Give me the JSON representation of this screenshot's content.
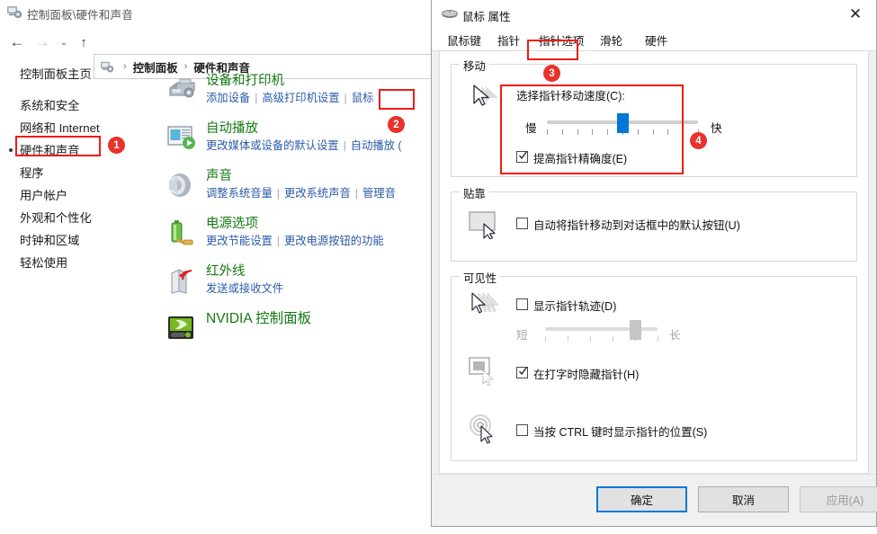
{
  "explorer": {
    "title": "控制面板\\硬件和声音",
    "title_icon": "control-panel-icon",
    "close_label": "✕",
    "nav": {
      "back": "←",
      "forward": "→",
      "recent": "⌄",
      "up": "↑"
    },
    "breadcrumb": {
      "items": [
        "控制面板",
        "硬件和声音"
      ],
      "separator": "›"
    },
    "search_icon": "search-icon",
    "left_nav": {
      "home": "控制面板主页",
      "items": [
        "系统和安全",
        "网络和 Internet",
        "硬件和声音",
        "程序",
        "用户帐户",
        "外观和个性化",
        "时钟和区域",
        "轻松使用"
      ],
      "selected": "硬件和声音"
    },
    "categories": [
      {
        "icon": "printer-icon",
        "title": "设备和打印机",
        "links": [
          "添加设备",
          "高级打印机设置",
          "鼠标"
        ]
      },
      {
        "icon": "autoplay-icon",
        "title": "自动播放",
        "links": [
          "更改媒体或设备的默认设置",
          "自动播放 ("
        ]
      },
      {
        "icon": "speaker-icon",
        "title": "声音",
        "links": [
          "调整系统音量",
          "更改系统声音",
          "管理音"
        ]
      },
      {
        "icon": "battery-icon",
        "title": "电源选项",
        "links": [
          "更改节能设置",
          "更改电源按钮的功能"
        ]
      },
      {
        "icon": "infrared-icon",
        "title": "红外线",
        "links": [
          "发送或接收文件"
        ]
      },
      {
        "icon": "nvidia-icon",
        "title": "NVIDIA 控制面板",
        "links": []
      }
    ]
  },
  "annotations": {
    "accent_color": "#e8322b",
    "markers": [
      "1",
      "2",
      "3",
      "4"
    ]
  },
  "dialog": {
    "title": "鼠标 属性",
    "title_icon": "mouse-icon",
    "close_label": "✕",
    "tabs": [
      {
        "label": "鼠标键",
        "active": false
      },
      {
        "label": "指针",
        "active": false
      },
      {
        "label": "指针选项",
        "active": true
      },
      {
        "label": "滑轮",
        "active": false
      },
      {
        "label": "硬件",
        "active": false
      }
    ],
    "groups": {
      "motion": {
        "label": "移动",
        "icon": "pointer-speed-icon",
        "speed_label": "选择指针移动速度(C):",
        "slider": {
          "min_label": "慢",
          "max_label": "快",
          "ticks": 11,
          "value": 5,
          "enabled": true
        },
        "enhance_precision": {
          "label": "提高指针精确度(E)",
          "checked": true,
          "enabled": true
        }
      },
      "snap": {
        "label": "贴靠",
        "icon": "snap-to-button-icon",
        "snap_default": {
          "label": "自动将指针移动到对话框中的默认按钮(U)",
          "checked": false,
          "enabled": true
        }
      },
      "visibility": {
        "label": "可见性",
        "trails": {
          "icon": "pointer-trails-icon",
          "label": "显示指针轨迹(D)",
          "checked": false,
          "enabled": true,
          "slider": {
            "min_label": "短",
            "max_label": "长",
            "ticks": 6,
            "value": 5,
            "enabled": false
          }
        },
        "hide_typing": {
          "icon": "hide-while-typing-icon",
          "label": "在打字时隐藏指针(H)",
          "checked": true,
          "enabled": true
        },
        "show_location": {
          "icon": "ctrl-locate-icon",
          "label": "当按 CTRL 键时显示指针的位置(S)",
          "checked": false,
          "enabled": true
        }
      }
    },
    "buttons": {
      "ok": "确定",
      "cancel": "取消",
      "apply": "应用(A)",
      "apply_enabled": false
    }
  }
}
